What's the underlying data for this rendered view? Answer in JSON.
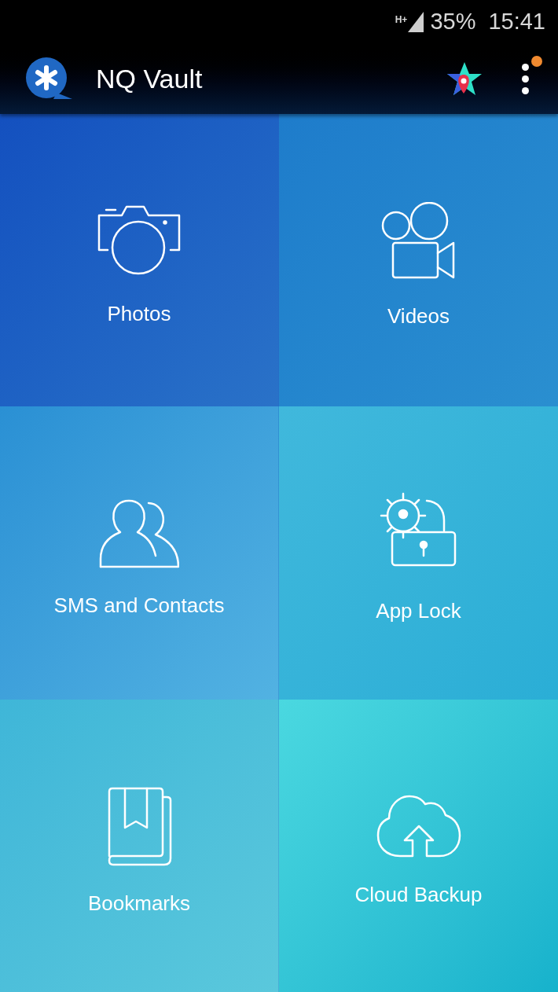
{
  "status_bar": {
    "network": "H+",
    "battery": "35%",
    "time": "15:41"
  },
  "app_bar": {
    "title": "NQ Vault",
    "menu_notification": true
  },
  "tiles": [
    {
      "kind": "photos",
      "label": "Photos"
    },
    {
      "kind": "videos",
      "label": "Videos"
    },
    {
      "kind": "contacts",
      "label": "SMS and Contacts"
    },
    {
      "kind": "applock",
      "label": "App Lock"
    },
    {
      "kind": "bookmarks",
      "label": "Bookmarks"
    },
    {
      "kind": "cloud",
      "label": "Cloud Backup"
    }
  ]
}
